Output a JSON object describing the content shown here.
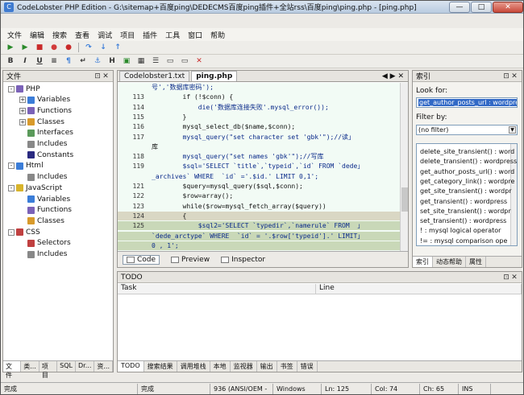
{
  "window": {
    "title": "CodeLobster PHP Edition - G:\\sitemap+百度ping\\DEDECMS百度ping插件+全站rss\\百度ping\\ping.php - [ping.php]",
    "min": "—",
    "max": "□",
    "close": "✕"
  },
  "menu": [
    "文件",
    "编辑",
    "搜索",
    "查看",
    "调试",
    "项目",
    "插件",
    "工具",
    "窗口",
    "帮助"
  ],
  "left_panel": {
    "title": "文件",
    "tree": [
      {
        "label": "PHP",
        "level": 0,
        "exp": "-",
        "color": "#7b62b8"
      },
      {
        "label": "Variables",
        "level": 1,
        "exp": "+",
        "color": "#3b7dd8"
      },
      {
        "label": "Functions",
        "level": 1,
        "exp": "+",
        "color": "#7b62b8"
      },
      {
        "label": "Classes",
        "level": 1,
        "exp": "+",
        "color": "#d89a2b"
      },
      {
        "label": "Interfaces",
        "level": 1,
        "exp": "",
        "color": "#5a9a5a"
      },
      {
        "label": "Includes",
        "level": 1,
        "exp": "",
        "color": "#888888"
      },
      {
        "label": "Constants",
        "level": 1,
        "exp": "",
        "color": "#2a2a80"
      },
      {
        "label": "Html",
        "level": 0,
        "exp": "-",
        "color": "#3b7dd8"
      },
      {
        "label": "Includes",
        "level": 1,
        "exp": "",
        "color": "#888888"
      },
      {
        "label": "JavaScript",
        "level": 0,
        "exp": "-",
        "color": "#d8b42b"
      },
      {
        "label": "Variables",
        "level": 1,
        "exp": "",
        "color": "#3b7dd8"
      },
      {
        "label": "Functions",
        "level": 1,
        "exp": "",
        "color": "#7b62b8"
      },
      {
        "label": "Classes",
        "level": 1,
        "exp": "",
        "color": "#d89a2b"
      },
      {
        "label": "CSS",
        "level": 0,
        "exp": "-",
        "color": "#c04040"
      },
      {
        "label": "Selectors",
        "level": 1,
        "exp": "",
        "color": "#c04040"
      },
      {
        "label": "Includes",
        "level": 1,
        "exp": "",
        "color": "#888888"
      }
    ],
    "tabs": [
      "文件",
      "类...",
      "项目",
      "SQL",
      "Dr...",
      "资..."
    ]
  },
  "editor": {
    "tabs": [
      "Codelobster1.txt",
      "ping.php"
    ],
    "active_tab": "ping.php",
    "lines": [
      {
        "num": "",
        "text": "号','数据库密码');",
        "hl": ""
      },
      {
        "num": "113",
        "text": "        if (!$conn) {",
        "hl": ""
      },
      {
        "num": "114",
        "text": "            die('数据库连接失败'.mysql_error());",
        "hl": ""
      },
      {
        "num": "115",
        "text": "        }",
        "hl": ""
      },
      {
        "num": "116",
        "text": "        mysql_select_db($name,$conn);",
        "hl": ""
      },
      {
        "num": "117",
        "text": "        mysql_query(\"set character set 'gbk'\");//读」",
        "hl": ""
      },
      {
        "num": "",
        "text": "库",
        "hl": ""
      },
      {
        "num": "118",
        "text": "        mysql_query(\"set names 'gbk'\");//写库",
        "hl": ""
      },
      {
        "num": "119",
        "text": "        $sql='SELECT `title`,`typeid`,`id` FROM `dede」",
        "hl": ""
      },
      {
        "num": "",
        "text": "_archives` WHERE  `id` ='.$id.' LIMIT 0,1';",
        "hl": ""
      },
      {
        "num": "121",
        "text": "        $query=mysql_query($sql,$conn);",
        "hl": ""
      },
      {
        "num": "122",
        "text": "        $row=array();",
        "hl": ""
      },
      {
        "num": "123",
        "text": "        while($row=mysql_fetch_array($query))",
        "hl": ""
      },
      {
        "num": "124",
        "text": "        {",
        "hl": "hl"
      },
      {
        "num": "125",
        "text": "            $sql2='SELECT `typedir`,`namerule` FROM  」",
        "hl": "hl2"
      },
      {
        "num": "",
        "text": "`dede_arctype` WHERE  `id` = '.$row['typeid'].' LIMIT」",
        "hl": "hl2"
      },
      {
        "num": "",
        "text": "0 , 1';",
        "hl": "hl2"
      }
    ],
    "bottom_tabs": [
      "Code",
      "Preview",
      "Inspector"
    ]
  },
  "right_panel": {
    "title": "索引",
    "look_for_label": "Look for:",
    "look_for_value": "get_author_posts_url : wordpre",
    "filter_label": "Filter by:",
    "filter_value": "(no filter)",
    "items": [
      "delete_site_transient() : word",
      "delete_transient() : wordpress",
      "get_author_posts_url() : word",
      "get_category_link() : wordpre",
      "get_site_transient() : wordpr",
      "get_transient() : wordpress",
      "set_site_transient() : wordpr",
      "set_transient() : wordpress",
      "! : mysql logical operator",
      "!= : mysql comparison ope"
    ],
    "tabs": [
      "索引",
      "动态帮助",
      "属性"
    ]
  },
  "todo": {
    "title": "TODO",
    "columns": [
      "Task",
      "Line"
    ],
    "tabs": [
      "TODO",
      "搜索结果",
      "调用堆栈",
      "本地",
      "监视器",
      "输出",
      "书签",
      "错误"
    ]
  },
  "status": [
    "完成",
    "完成",
    "936 (ANSI/OEM -",
    "Windows",
    "Ln: 125",
    "Col: 74",
    "Ch: 65",
    "INS"
  ]
}
